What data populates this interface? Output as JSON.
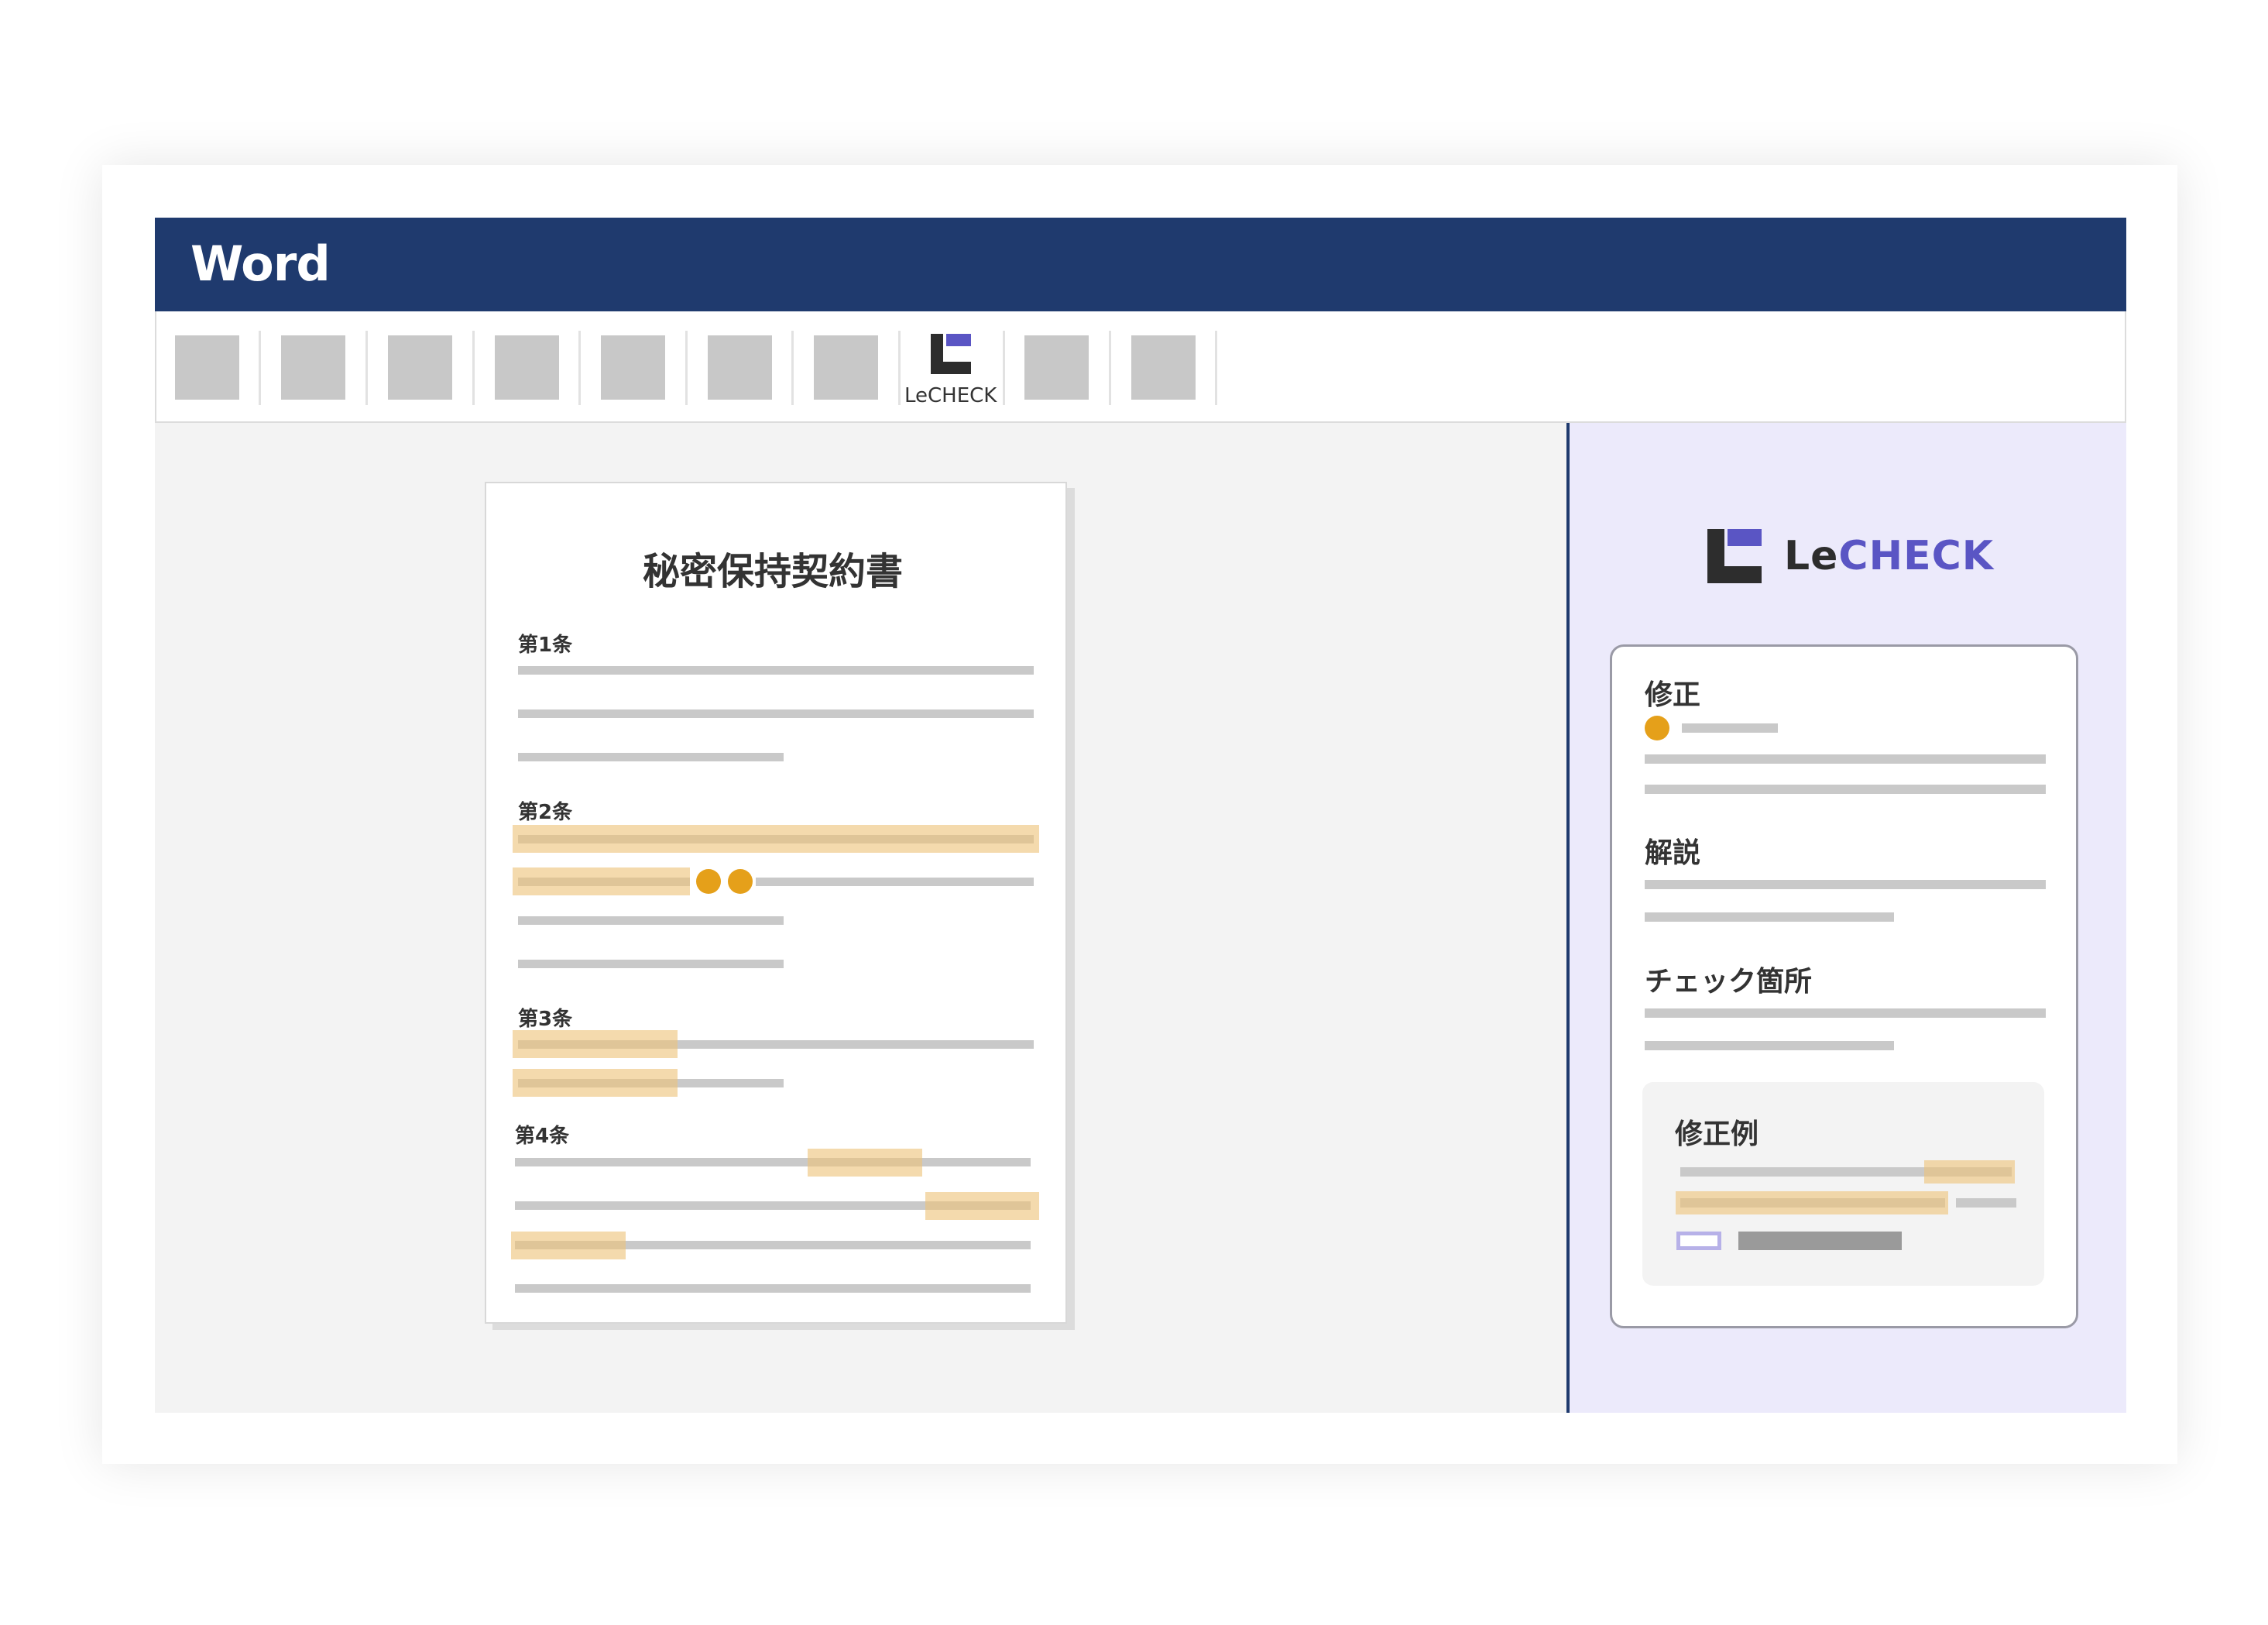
{
  "window": {
    "app_title": "Word"
  },
  "ribbon": {
    "buttons": [
      "",
      "",
      "",
      "",
      "",
      "",
      "",
      "",
      ""
    ],
    "lecheck_label": "LeCHECK"
  },
  "document": {
    "title": "秘密保持契約書",
    "articles": [
      "第1条",
      "第2条",
      "第3条",
      "第4条"
    ]
  },
  "panel": {
    "brand": {
      "prefix": "Le",
      "suffix": "CHECK"
    },
    "sections": {
      "correction": "修正",
      "explanation": "解説",
      "check_points": "チェック箇所",
      "correction_example": "修正例"
    }
  },
  "colors": {
    "titlebar": "#1f3a6e",
    "brand_purple": "#5a55c4",
    "highlight": "#eec47a",
    "marker_orange": "#e5a01a",
    "panel_background": "#eceafb"
  },
  "icons": {
    "brand_logo": "lecheck-logo-icon",
    "ribbon_buttons": "ribbon-button-icon"
  }
}
